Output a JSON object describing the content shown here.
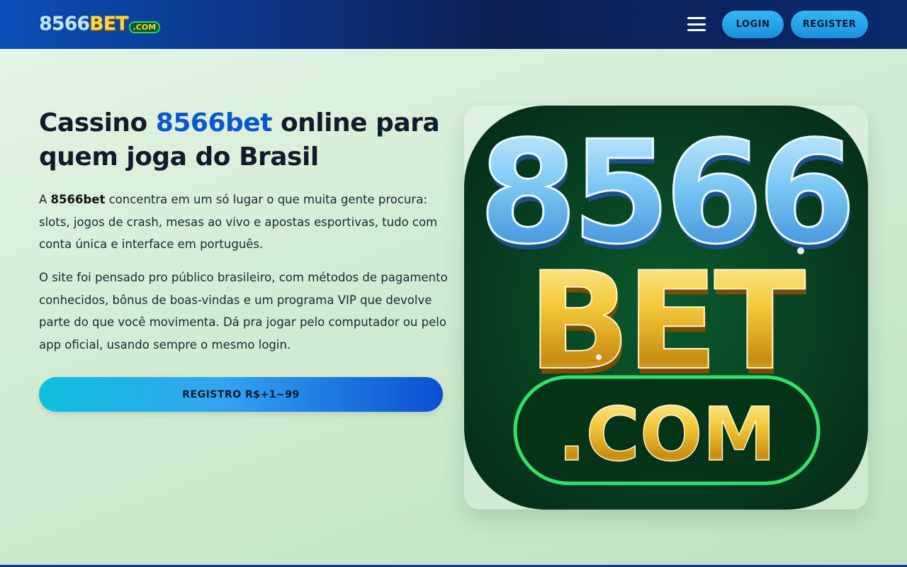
{
  "header": {
    "logo_text": "8566",
    "logo_text_gold": "BET",
    "logo_com": ".COM",
    "login_label": "LOGIN",
    "register_label": "REGISTER"
  },
  "hero": {
    "title_part1": "Cassino ",
    "title_accent": "8566bet",
    "title_part2": " online para quem joga do Brasil",
    "p1_prefix": "A ",
    "p1_bold": "8566bet",
    "p1_rest": " concentra em um só lugar o que muita gente procura: slots, jogos de crash, mesas ao vivo e apostas esportivas, tudo com conta única e interface em português.",
    "p2": "O site foi pensado pro público brasileiro, com métodos de pagamento conhecidos, bônus de boas-vindas e um programa VIP que devolve parte do que você movimenta. Dá pra jogar pelo computador ou pelo app oficial, usando sempre o mesmo login.",
    "cta_label": "REGISTRO R$+1~99"
  },
  "hero_image": {
    "line1": "8566",
    "line2": "BET",
    "line3": ".COM"
  },
  "colors": {
    "accent": "#0b57cf",
    "header_bg": "#0d1f52",
    "button_blue": "#35b7f4"
  }
}
